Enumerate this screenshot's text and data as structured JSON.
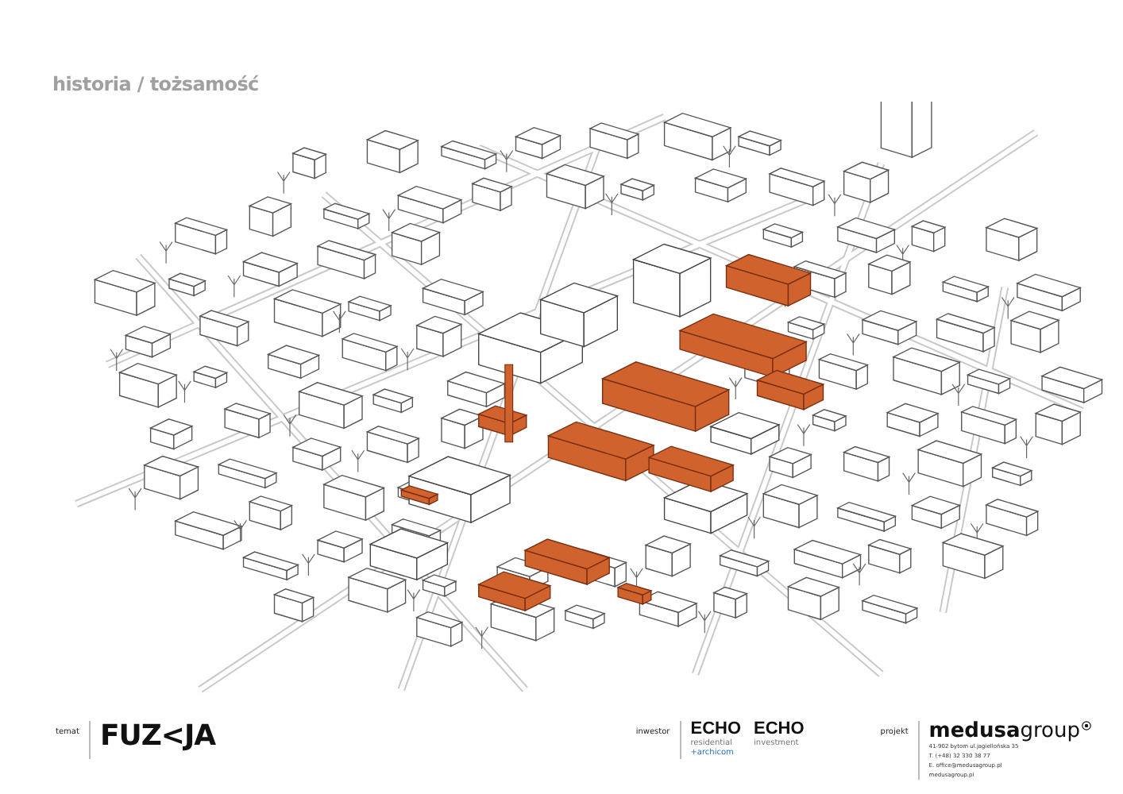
{
  "header": {
    "title": "historia / tożsamość"
  },
  "footer": {
    "topic": {
      "label": "temat",
      "name": "FUZ<JA"
    },
    "investor": {
      "label": "inwestor",
      "logos": [
        {
          "name": "ECHO",
          "sub": "residential",
          "extra": "+archicom"
        },
        {
          "name": "ECHO",
          "sub": "investment"
        }
      ]
    },
    "project": {
      "label": "projekt",
      "brand_main": "medusa",
      "brand_rest": "group",
      "lines": [
        "41-902 bytom ul.jagiellońska 35",
        "T. (+48) 32 330 38 77",
        "E. office@medusagroup.pl",
        "medusagroup.pl"
      ]
    }
  }
}
